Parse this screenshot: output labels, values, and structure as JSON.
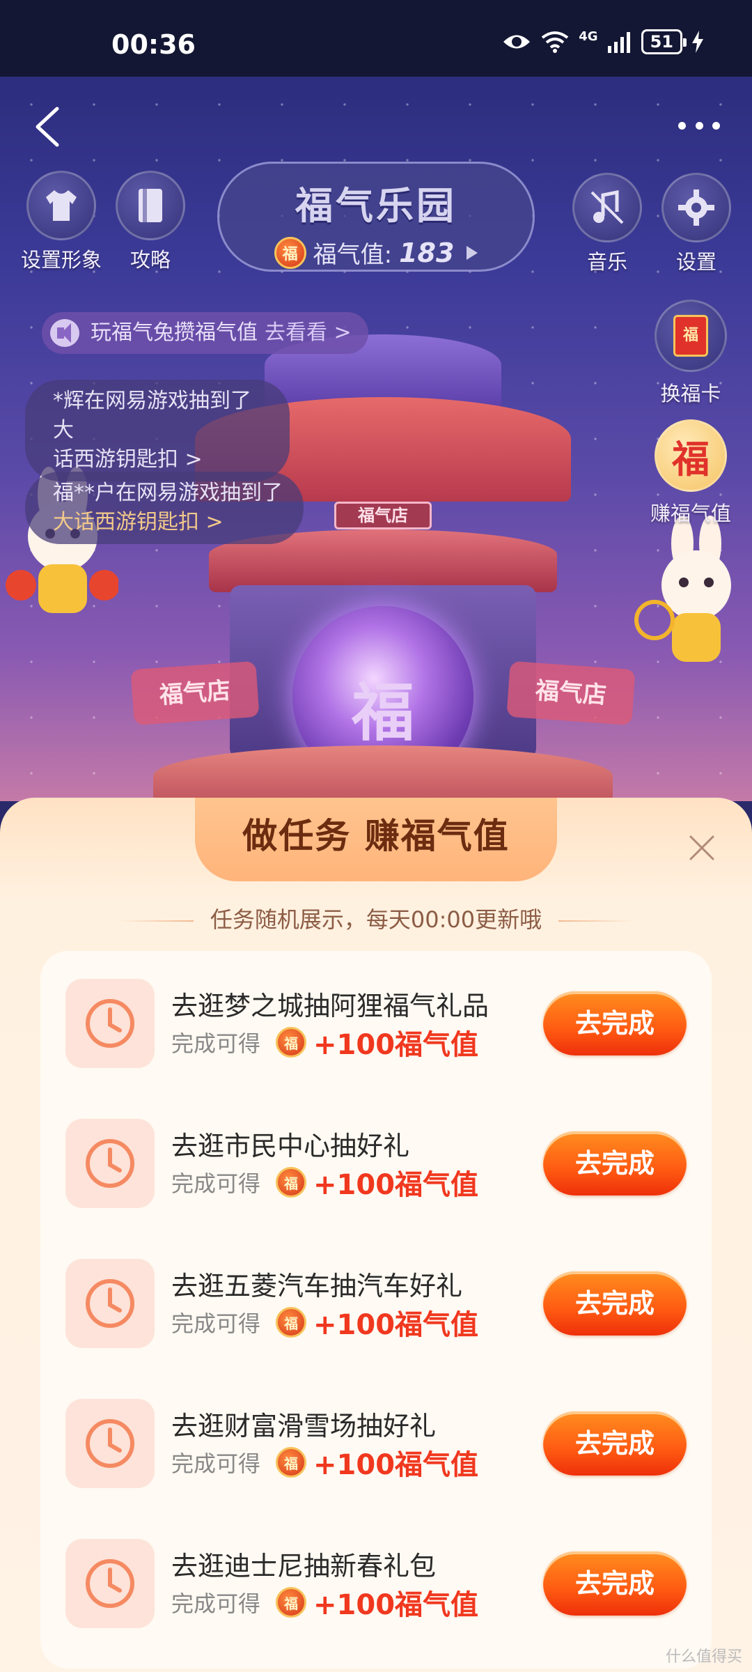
{
  "status_bar": {
    "time": "00:36",
    "network": "4G",
    "battery": "51"
  },
  "header": {
    "title": "福气乐园",
    "value_label": "福气值:",
    "value": "183",
    "fu_char": "福"
  },
  "top_buttons": {
    "avatar_label": "设置形象",
    "guide_label": "攻略",
    "music_label": "音乐",
    "settings_label": "设置"
  },
  "side_buttons": {
    "exchange_label": "换福卡",
    "earn_label": "赚福气值"
  },
  "marquee": {
    "text": "玩福气兔攒福气值",
    "link": "去看看 >"
  },
  "tickers": [
    {
      "line1": "*辉在网易游戏抽到了大",
      "line2": "话西游钥匙扣 >"
    },
    {
      "line1": "福**户在网易游戏抽到了",
      "line2": "大话西游钥匙扣 >"
    }
  ],
  "scene_signs": {
    "top": "福气店",
    "left": "福气店",
    "right": "福气店",
    "orb": "福"
  },
  "panel": {
    "title": "做任务 赚福气值",
    "subtitle": "任务随机展示，每天00:00更新哦"
  },
  "tasks": [
    {
      "title": "去逛梦之城抽阿狸福气礼品",
      "reward_label": "完成可得",
      "reward": "+100福气值",
      "button": "去完成"
    },
    {
      "title": "去逛市民中心抽好礼",
      "reward_label": "完成可得",
      "reward": "+100福气值",
      "button": "去完成"
    },
    {
      "title": "去逛五菱汽车抽汽车好礼",
      "reward_label": "完成可得",
      "reward": "+100福气值",
      "button": "去完成"
    },
    {
      "title": "去逛财富滑雪场抽好礼",
      "reward_label": "完成可得",
      "reward": "+100福气值",
      "button": "去完成"
    },
    {
      "title": "去逛迪士尼抽新春礼包",
      "reward_label": "完成可得",
      "reward": "+100福气值",
      "button": "去完成"
    }
  ],
  "watermark": "什么值得买",
  "colors": {
    "accent": "#ff5a12",
    "reward": "#f0381f",
    "panel_bg": "#fff3e6",
    "scene_bg": "#3b3a97"
  }
}
